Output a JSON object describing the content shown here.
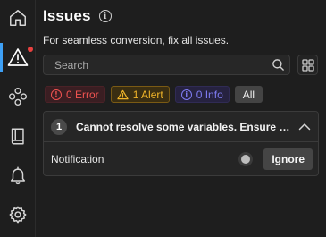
{
  "panel": {
    "title": "Issues",
    "subtitle": "For seamless conversion, fix all issues."
  },
  "search": {
    "placeholder": "Search",
    "value": ""
  },
  "filters": {
    "error_label": "0 Error",
    "alert_label": "1 Alert",
    "info_label": "0 Info",
    "all_label": "All"
  },
  "issue": {
    "number": "1",
    "title": "Cannot resolve some variables. Ensure the variables are defined.",
    "row_label": "Notification",
    "ignore_label": "Ignore"
  },
  "rail": {
    "items": [
      "home-icon",
      "warning-icon",
      "components-icon",
      "book-icon",
      "bell-icon",
      "gear-icon"
    ],
    "active": "warning-icon"
  },
  "colors": {
    "accent": "#3ea0f5",
    "error": "#ef5350",
    "alert": "#f0b429",
    "info": "#7e7bf0",
    "notification_dot": "#e9413f"
  }
}
